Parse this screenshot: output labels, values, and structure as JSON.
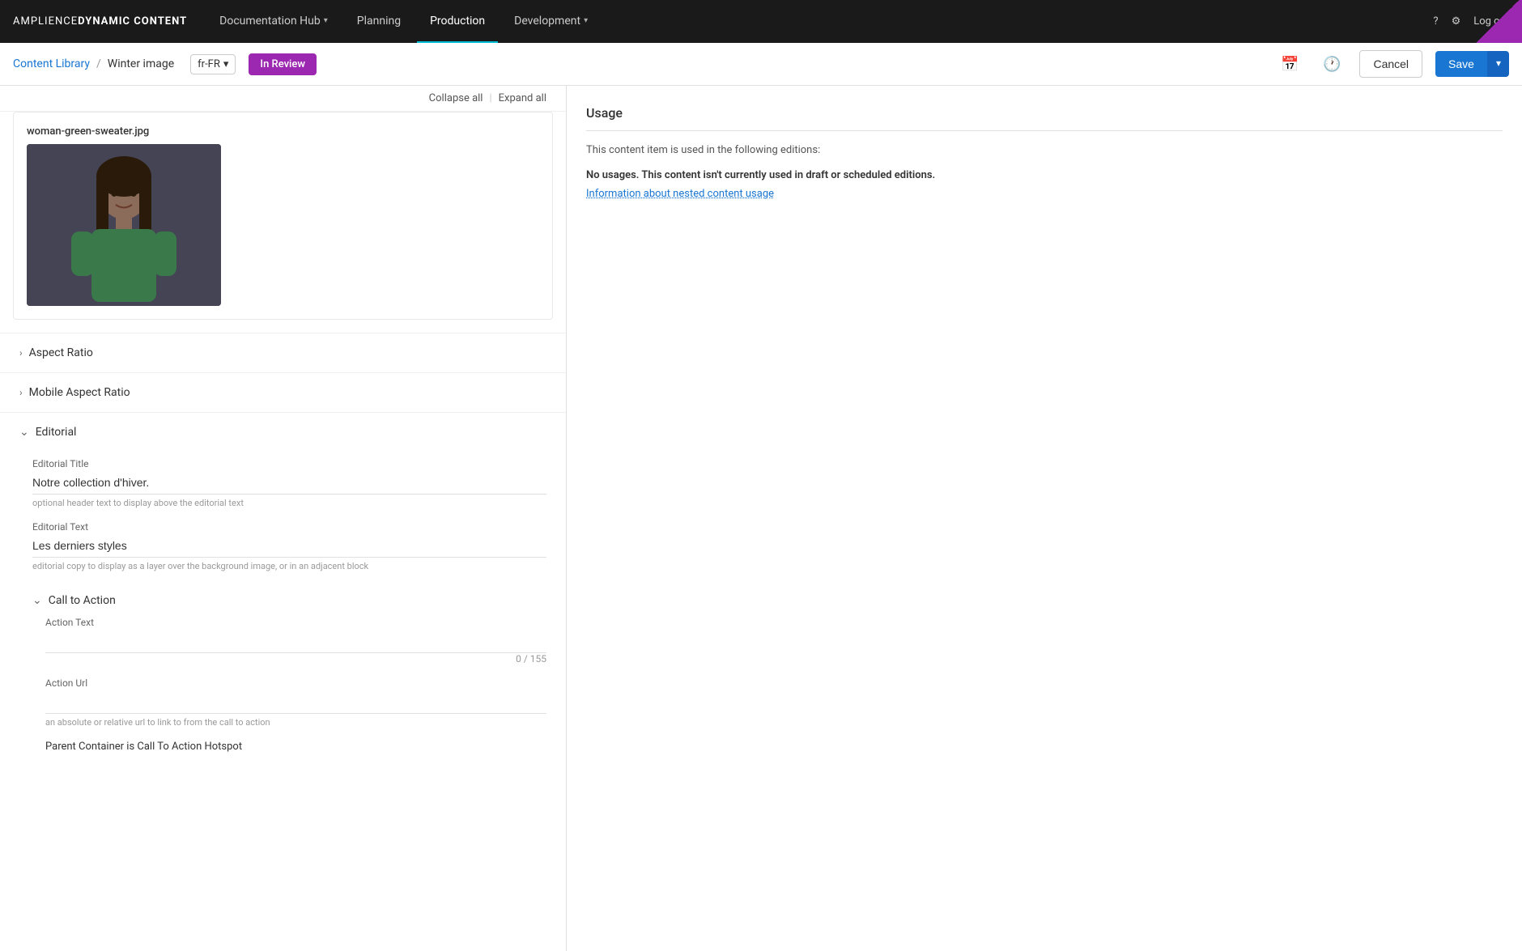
{
  "brand": {
    "name_amplience": "AMPLIENCE",
    "name_dynamic": " DYNAMIC",
    "name_content": " CONTENT"
  },
  "nav": {
    "items": [
      {
        "label": "Documentation Hub",
        "active": false,
        "hasChevron": true
      },
      {
        "label": "Planning",
        "active": false,
        "hasChevron": false
      },
      {
        "label": "Production",
        "active": true,
        "hasChevron": false
      },
      {
        "label": "Development",
        "active": false,
        "hasChevron": true
      }
    ],
    "right_items": [
      "help-icon",
      "settings-icon",
      "logout"
    ],
    "logout_label": "Log out"
  },
  "breadcrumb": {
    "library": "Content Library",
    "separator": "/",
    "item": "Winter image",
    "lang": "fr-FR",
    "status": "In Review"
  },
  "toolbar": {
    "collapse_label": "Collapse all",
    "expand_label": "Expand all",
    "separator": "|",
    "cancel_label": "Cancel",
    "save_label": "Save"
  },
  "image_section": {
    "filename": "woman-green-sweater.jpg"
  },
  "sections": [
    {
      "id": "aspect-ratio",
      "label": "Aspect Ratio",
      "expanded": false,
      "chevron": "›"
    },
    {
      "id": "mobile-aspect-ratio",
      "label": "Mobile Aspect Ratio",
      "expanded": false,
      "chevron": "›"
    },
    {
      "id": "editorial",
      "label": "Editorial",
      "expanded": true,
      "chevron": "⌄"
    }
  ],
  "editorial": {
    "title_label": "Editorial Title",
    "title_value": "Notre collection d'hiver.",
    "title_hint": "optional header text to display above the editorial text",
    "text_label": "Editorial Text",
    "text_value": "Les derniers styles",
    "text_hint": "editorial copy to display as a layer over the background image, or in an adjacent block"
  },
  "cta": {
    "label": "Call to Action",
    "expanded": true,
    "chevron": "⌄",
    "action_text_label": "Action Text",
    "action_text_placeholder": "",
    "action_text_char_count": "0 / 155",
    "action_url_label": "Action Url",
    "action_url_placeholder": "",
    "action_url_hint": "an absolute or relative url to link to from the call to action",
    "parent_container_label": "Parent Container is Call To Action Hotspot"
  },
  "usage": {
    "title": "Usage",
    "description": "This content item is used in the following editions:",
    "no_usage_text": "No usages. This content isn't currently used in draft or scheduled editions.",
    "info_link": "Information about nested content usage"
  }
}
